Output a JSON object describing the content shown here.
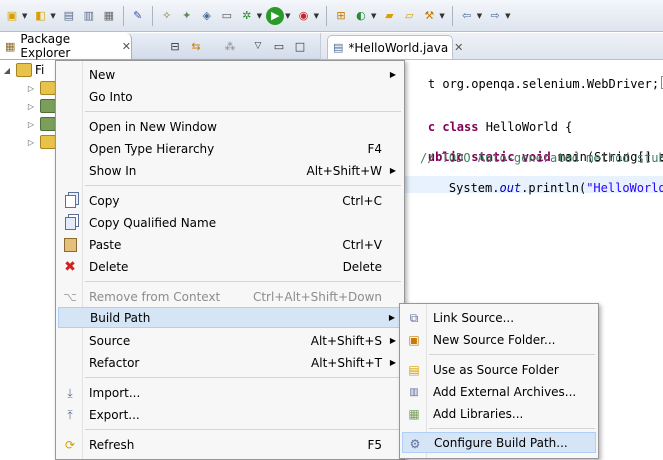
{
  "toolbar": {
    "icons": [
      "new-icon",
      "new-wizard-icon",
      "save-icon",
      "save-all-icon",
      "print-icon",
      "pin-icon",
      "profile-icon",
      "coverage-icon",
      "build-icon",
      "layout-icon",
      "debug-bug-icon",
      "run-icon",
      "run-external-icon",
      "open-type-icon",
      "new-class-icon",
      "open-folder-icon",
      "open-file-icon",
      "wand-icon",
      "back-arrow-icon",
      "forward-arrow-icon"
    ]
  },
  "package_explorer": {
    "tab_label": "Package Explorer",
    "tree": [
      {
        "label": "Fi"
      },
      {
        "label": ""
      },
      {
        "label": ""
      },
      {
        "label": ""
      },
      {
        "label": ""
      }
    ]
  },
  "editor": {
    "tab_label": "*HelloWorld.java",
    "code_lines": [
      {
        "plain": "t org.openqa.selenium.WebDriver;"
      },
      {
        "kw": "c class",
        "plain": " HelloWorld {"
      },
      {
        "kw": "ublic static void",
        "plain": " main(String[] args)"
      },
      {
        "comment": "// TODO Auto-generated method stub"
      },
      {
        "pre": "System.",
        "field": "out",
        "mid": ".println(",
        "str": "\"HelloWorld!\"",
        "post": ");"
      }
    ]
  },
  "context_menu": {
    "items": [
      {
        "label": "New",
        "shortcut": "",
        "submenu": true,
        "icon": ""
      },
      {
        "label": "Go Into",
        "shortcut": "",
        "icon": ""
      },
      {
        "label": "Open in New Window",
        "shortcut": "",
        "icon": ""
      },
      {
        "label": "Open Type Hierarchy",
        "shortcut": "F4",
        "icon": ""
      },
      {
        "label": "Show In",
        "shortcut": "Alt+Shift+W",
        "submenu": true,
        "icon": ""
      },
      {
        "label": "Copy",
        "shortcut": "Ctrl+C",
        "icon": "copy-icon"
      },
      {
        "label": "Copy Qualified Name",
        "shortcut": "",
        "icon": "copy-qualified-icon"
      },
      {
        "label": "Paste",
        "shortcut": "Ctrl+V",
        "icon": "paste-icon"
      },
      {
        "label": "Delete",
        "shortcut": "Delete",
        "icon": "delete-icon"
      },
      {
        "label": "Remove from Context",
        "shortcut": "Ctrl+Alt+Shift+Down",
        "icon": "remove-context-icon",
        "disabled": true
      },
      {
        "label": "Build Path",
        "shortcut": "",
        "submenu": true,
        "highlighted": true,
        "icon": ""
      },
      {
        "label": "Source",
        "shortcut": "Alt+Shift+S",
        "submenu": true,
        "icon": ""
      },
      {
        "label": "Refactor",
        "shortcut": "Alt+Shift+T",
        "submenu": true,
        "icon": ""
      },
      {
        "label": "Import...",
        "shortcut": "",
        "icon": "import-icon"
      },
      {
        "label": "Export...",
        "shortcut": "",
        "icon": "export-icon"
      },
      {
        "label": "Refresh",
        "shortcut": "F5",
        "icon": "refresh-icon"
      }
    ]
  },
  "build_path_submenu": {
    "items": [
      {
        "label": "Link Source...",
        "icon": "link-source-icon"
      },
      {
        "label": "New Source Folder...",
        "icon": "new-source-folder-icon"
      },
      {
        "label": "Use as Source Folder",
        "icon": "use-source-folder-icon"
      },
      {
        "label": "Add External Archives...",
        "icon": "external-archives-icon"
      },
      {
        "label": "Add Libraries...",
        "icon": "add-libraries-icon"
      },
      {
        "label": "Configure Build Path...",
        "icon": "configure-build-path-icon",
        "highlighted": true
      }
    ]
  },
  "colors": {
    "menu_highlight": "#d6e5f5",
    "keyword": "#7f0055",
    "comment": "#3f7f5f",
    "string": "#2a00ff"
  }
}
